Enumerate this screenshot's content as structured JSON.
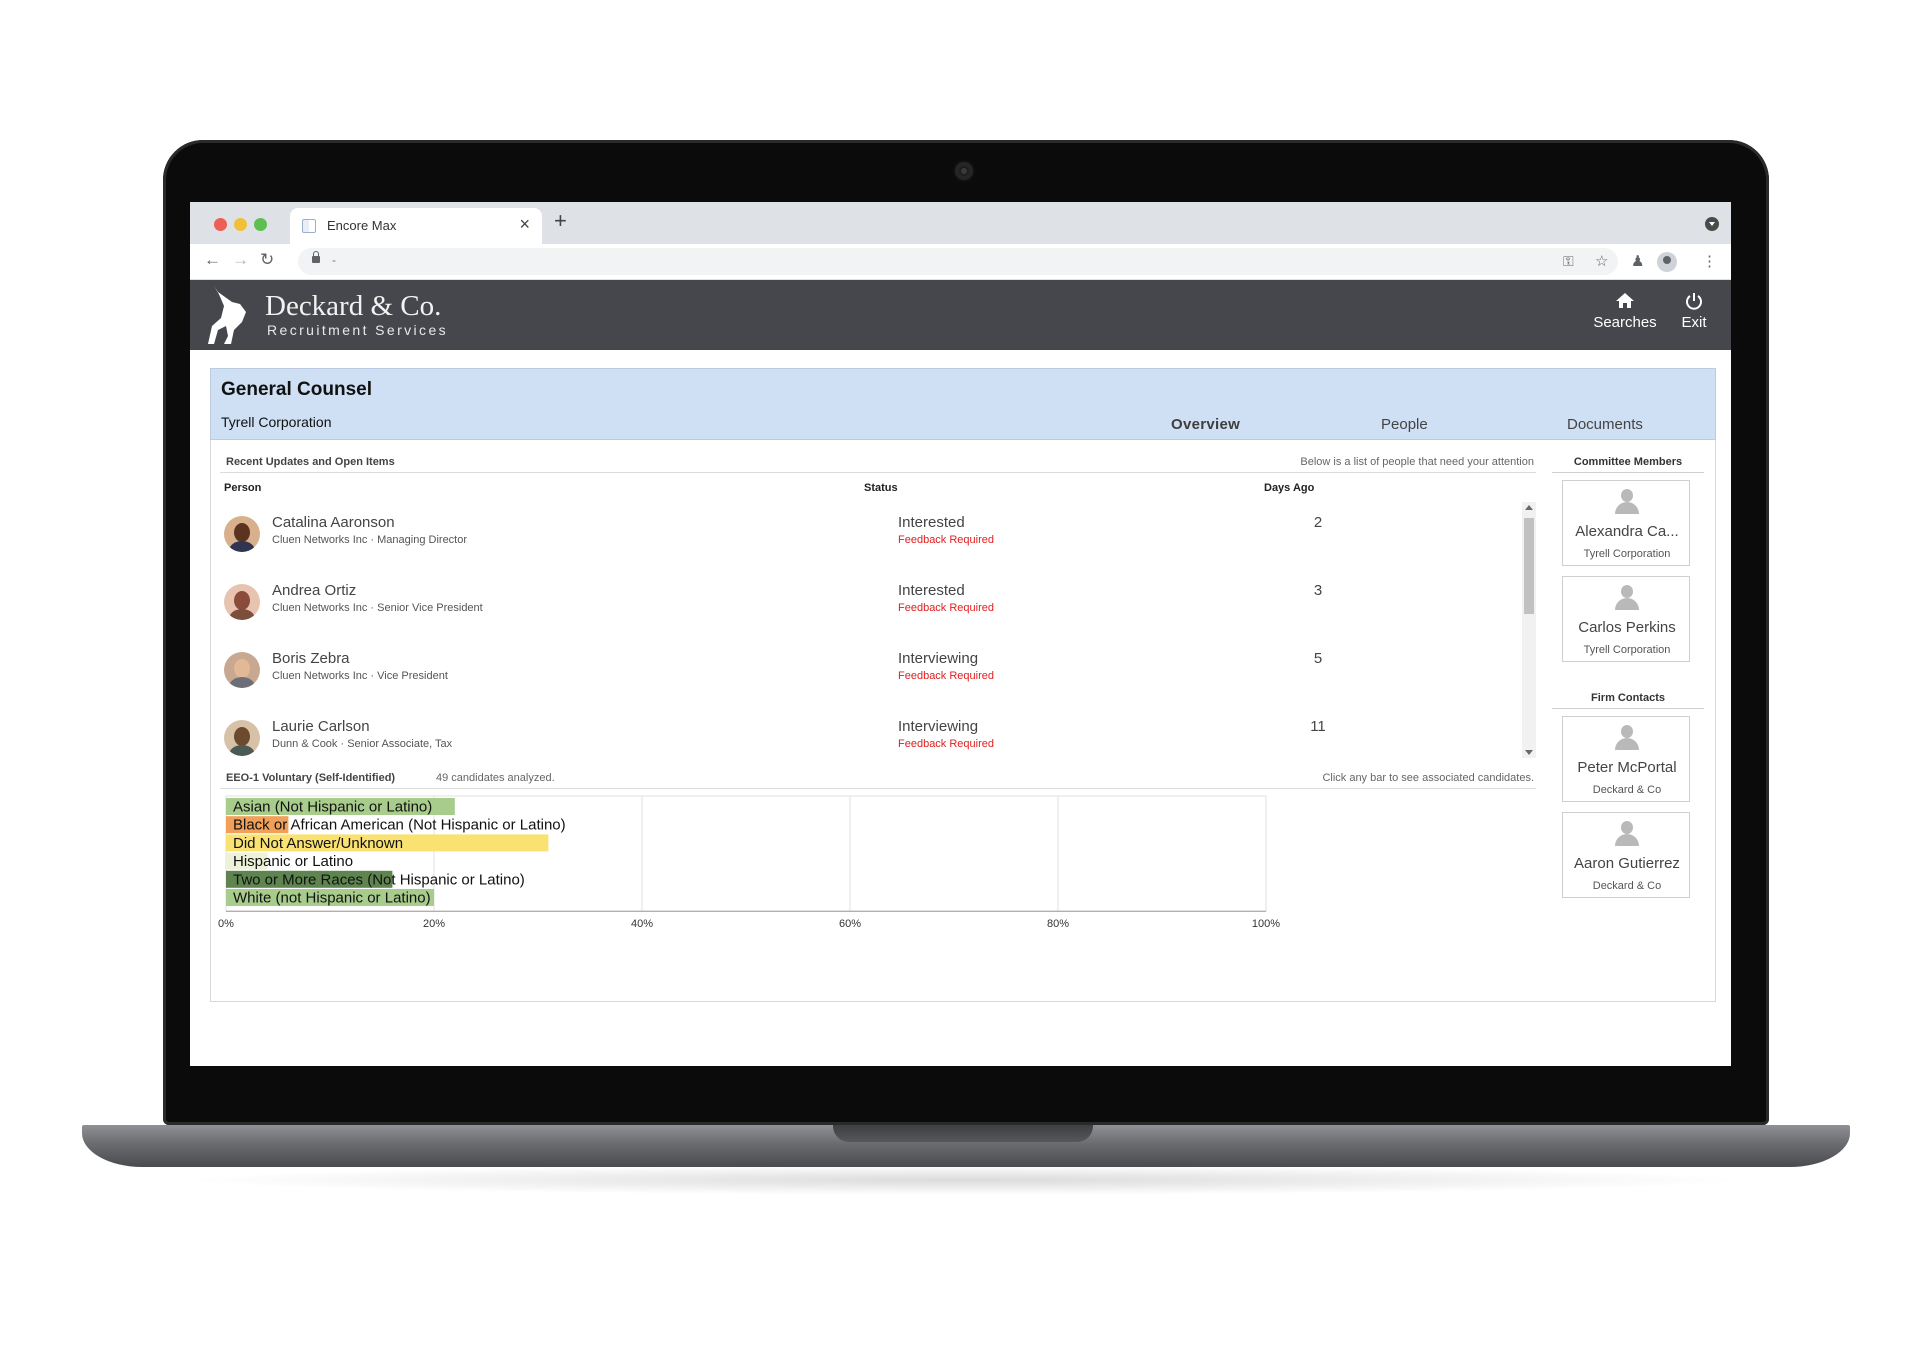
{
  "browser": {
    "tab_title": "Encore Max",
    "tab_close": "×",
    "new_tab": "+",
    "back": "←",
    "forward": "→",
    "reload": "↻",
    "url": "-",
    "star": "☆",
    "key": "⚿",
    "extension": "♟",
    "menu": "⋮"
  },
  "header": {
    "brand_title": "Deckard & Co.",
    "brand_subtitle": "Recruitment Services",
    "searches_label": "Searches",
    "exit_label": "Exit"
  },
  "search": {
    "title": "General Counsel",
    "company": "Tyrell Corporation",
    "tabs": [
      {
        "label": "Overview"
      },
      {
        "label": "People"
      },
      {
        "label": "Documents"
      }
    ]
  },
  "updates": {
    "title": "Recent Updates and Open Items",
    "note": "Below is a list of people that need your attention",
    "columns": {
      "person": "Person",
      "status": "Status",
      "days": "Days Ago"
    },
    "rows": [
      {
        "name": "Catalina Aaronson",
        "subtitle": "Cluen Networks Inc · Managing Director",
        "status": "Interested",
        "flag": "Feedback Required",
        "days": "2"
      },
      {
        "name": "Andrea Ortiz",
        "subtitle": "Cluen Networks Inc · Senior Vice President",
        "status": "Interested",
        "flag": "Feedback Required",
        "days": "3"
      },
      {
        "name": "Boris Zebra",
        "subtitle": "Cluen Networks Inc · Vice President",
        "status": "Interviewing",
        "flag": "Feedback Required",
        "days": "5"
      },
      {
        "name": "Laurie Carlson",
        "subtitle": "Dunn & Cook · Senior Associate, Tax",
        "status": "Interviewing",
        "flag": "Feedback Required",
        "days": "11"
      }
    ]
  },
  "eeo": {
    "title": "EEO-1 Voluntary (Self-Identified)",
    "count_text": "49 candidates analyzed.",
    "hint": "Click any bar to see associated candidates."
  },
  "chart_data": {
    "type": "bar",
    "orientation": "horizontal",
    "categories": [
      "Asian (Not Hispanic or Latino)",
      "Black or African American (Not Hispanic or Latino)",
      "Did Not Answer/Unknown",
      "Hispanic or Latino",
      "Two or More Races (Not Hispanic or Latino)",
      "White (not Hispanic or Latino)"
    ],
    "values": [
      22,
      6,
      31,
      4,
      16,
      20
    ],
    "colors": [
      "#a8cc8c",
      "#f0a058",
      "#f9e272",
      "#eef2d8",
      "#5e8550",
      "#a8cc8c"
    ],
    "x_ticks": [
      "0%",
      "20%",
      "40%",
      "60%",
      "80%",
      "100%"
    ],
    "xlim": [
      0,
      100
    ],
    "grid": true
  },
  "sidebar": {
    "committee_title": "Committee Members",
    "committee": [
      {
        "name": "Alexandra Ca...",
        "org": "Tyrell Corporation"
      },
      {
        "name": "Carlos Perkins",
        "org": "Tyrell Corporation"
      }
    ],
    "firm_title": "Firm Contacts",
    "firm": [
      {
        "name": "Peter McPortal",
        "org": "Deckard & Co"
      },
      {
        "name": "Aaron Gutierrez",
        "org": "Deckard & Co"
      }
    ]
  },
  "colors": {
    "header_bg": "#45474c",
    "banner_bg": "#cfdff4",
    "feedback_red": "#e02020"
  }
}
